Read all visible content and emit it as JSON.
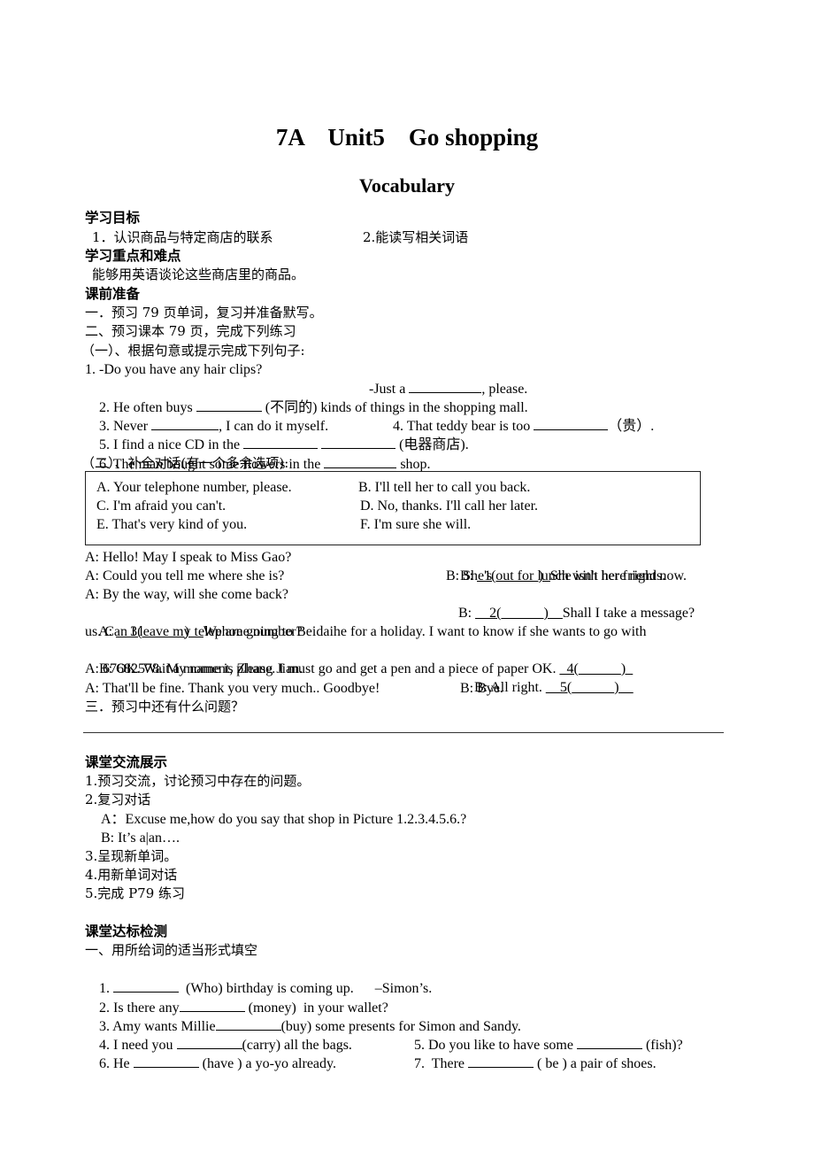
{
  "document": {
    "title": "7A    Unit5    Go shopping",
    "subtitle": "Vocabulary"
  },
  "goals": {
    "heading": "学习目标",
    "item1": "1．认识商品与特定商店的联系",
    "item2": "2.能读写相关词语"
  },
  "key_points": {
    "heading": "学习重点和难点",
    "text": "能够用英语谈论这些商店里的商品。"
  },
  "preview": {
    "heading": "课前准备",
    "task1": "一．预习 79 页单词，复习并准备默写。",
    "task2": "二、预习课本 79 页，完成下列练习",
    "part1_heading": "（一）、根据句意或提示完成下列句子:",
    "sentences": {
      "s1a": "1. -Do you have any hair clips?",
      "s1b_pre": "-Just a ",
      "s1b_post": ", please.",
      "s2_pre": "2. He often buys ",
      "s2_post": " (不同的) kinds of things in the shopping mall.",
      "s3_pre": "3. Never ",
      "s3_post": ", I can do it myself.",
      "s4_pre": "4. That teddy bear is too ",
      "s4_post": "（贵）.",
      "s5_pre": "5. I find a nice CD in the ",
      "s5_post": " (电器商店).",
      "s6_pre": "6. The man bought some flowers in the ",
      "s6_post": " shop."
    },
    "part2_heading": "（二）、补全对话(有一个多余选项):",
    "options": [
      "A. Your telephone number, please.",
      "B. I'll tell her to call you back.",
      "C. I'm afraid you can't.",
      "D. No, thanks. I'll call her later.",
      "E. That's very kind of you.",
      "F. I'm sure she will."
    ],
    "dialogue": {
      "l1a": "A: Hello! May I speak to Miss Gao?",
      "l1b_pre": "B: ",
      "l1b_blank": "_1(______)_",
      "l1b_post": "She isn't here right now.",
      "l2a": "A: Could you tell me where she is?",
      "l2b": "B: She's out for lunch with her friends.",
      "l3a": "A: By the way, will she come back?",
      "l3b_pre": "B: ",
      "l3b_blank": "__2(______)__",
      "l3b_post": "Shall I take a message?",
      "l4_pre": "A: ",
      "l4_blank": "__3(______)__",
      "l4_post": "We are going to Beidaihe for a holiday. I want to know if she wants to go with",
      "l5": "us. Can I leave my telephone number?",
      "l6_pre": "B: OK. Wait a moment, please. I must go and get a pen and a piece of paper OK. ",
      "l6_blank": "_4(______)_",
      "l7a": "A: 67682578. My name is Zhang Jian.",
      "l7b_pre": "B: All right. ",
      "l7b_blank": "__5(______)__",
      "l8a": "A: That'll be fine. Thank you very much.. Goodbye!",
      "l8b": "B: Bye."
    },
    "task3": "三．预习中还有什么问题？"
  },
  "classroom": {
    "heading": "课堂交流展示",
    "items": [
      "1.预习交流，讨论预习中存在的问题。",
      "2.复习对话",
      "A：Excuse me,how do you say that shop in Picture 1.2.3.4.5.6.?",
      "B: It’s a|an….",
      "3.呈现新单词。",
      "4.用新单词对话",
      "5.完成 P79 练习"
    ]
  },
  "test": {
    "heading": "课堂达标检测",
    "instruction": "一、用所给词的适当形式填空",
    "q1_pre": "1. ",
    "q1_post": "  (Who) birthday is coming up.      –Simon’s.",
    "q2_pre": "2. Is there any",
    "q2_post": " (money)  in your wallet?",
    "q3_pre": "3. Amy wants Millie",
    "q3_post": "(buy) some presents for Simon and Sandy.",
    "q4_pre": "4. I need you ",
    "q4_post": "(carry) all the bags.",
    "q5_pre": "5. Do you like to have some ",
    "q5_post": " (fish)?",
    "q6_pre": "6. He ",
    "q6_post": " (have ) a yo-yo already.",
    "q7_pre": "7.  There ",
    "q7_post": " ( be ) a pair of shoes."
  }
}
